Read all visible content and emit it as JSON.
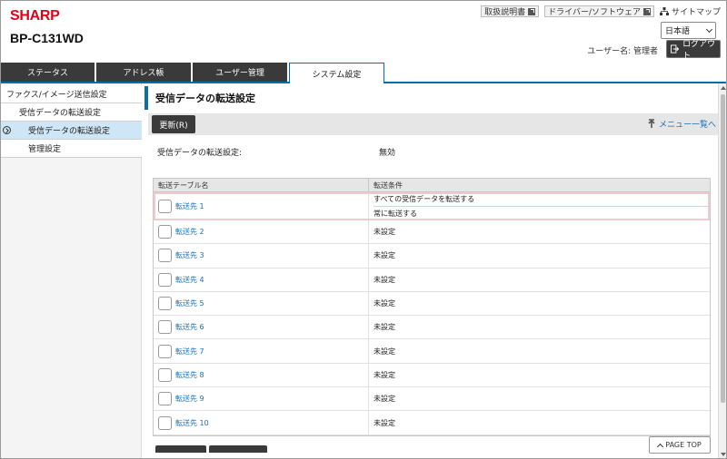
{
  "header": {
    "brand": "SHARP",
    "model": "BP-C131WD",
    "links": [
      {
        "label": "取扱説明書",
        "icon": "external-link-icon"
      },
      {
        "label": "ドライバー/ソフトウェア",
        "icon": "external-link-icon"
      }
    ],
    "sitemap_label": "サイトマップ",
    "language_selected": "日本語",
    "user_label": "ユーザー名: 管理者",
    "logout_label": "ログアウト"
  },
  "tabs": [
    {
      "label": "ステータス",
      "active": false
    },
    {
      "label": "アドレス帳",
      "active": false
    },
    {
      "label": "ユーザー管理",
      "active": false
    },
    {
      "label": "システム設定",
      "active": true
    }
  ],
  "sidebar": {
    "items": [
      {
        "label": "ファクス/イメージ送信設定",
        "level": 0
      },
      {
        "label": "受信データの転送設定",
        "level": 1
      },
      {
        "label": "受信データの転送設定",
        "level": 2,
        "active": true
      },
      {
        "label": "管理設定",
        "level": 1
      }
    ]
  },
  "main": {
    "title": "受信データの転送設定",
    "update_button": "更新(R)",
    "menu_link": "メニュー一覧へ",
    "setting_label": "受信データの転送設定:",
    "setting_value": "無効",
    "table": {
      "headers": [
        "転送テーブル名",
        "転送条件"
      ],
      "rows": [
        {
          "name": "転送先 1",
          "conditions": [
            "すべての受信データを転送する",
            "常に転送する"
          ]
        },
        {
          "name": "転送先 2",
          "conditions": [
            "未設定"
          ]
        },
        {
          "name": "転送先 3",
          "conditions": [
            "未設定"
          ]
        },
        {
          "name": "転送先 4",
          "conditions": [
            "未設定"
          ]
        },
        {
          "name": "転送先 5",
          "conditions": [
            "未設定"
          ]
        },
        {
          "name": "転送先 6",
          "conditions": [
            "未設定"
          ]
        },
        {
          "name": "転送先 7",
          "conditions": [
            "未設定"
          ]
        },
        {
          "name": "転送先 8",
          "conditions": [
            "未設定"
          ]
        },
        {
          "name": "転送先 9",
          "conditions": [
            "未設定"
          ]
        },
        {
          "name": "転送先 10",
          "conditions": [
            "未設定"
          ]
        }
      ]
    },
    "page_top": "PAGE TOP"
  },
  "colors": {
    "brand_red": "#e2001a",
    "accent_blue": "#0a6ea6",
    "link_blue": "#1a6fb5",
    "dark_button": "#3a3a3a",
    "highlight_border": "#f3c8cf"
  }
}
